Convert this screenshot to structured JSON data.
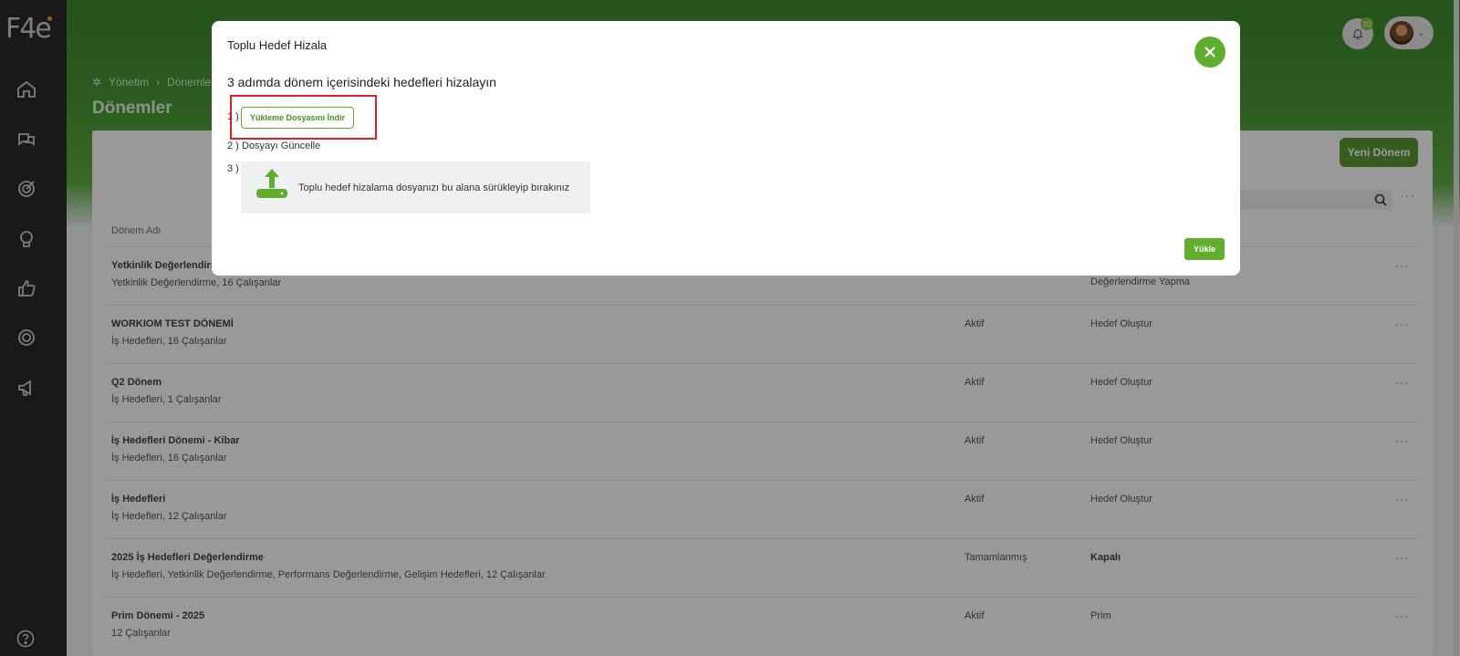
{
  "sidebar": {
    "logo": "F4e",
    "items": [
      {
        "icon": "home-icon"
      },
      {
        "icon": "chat-icon"
      },
      {
        "icon": "target-icon"
      },
      {
        "icon": "lightbulb-icon"
      },
      {
        "icon": "thumbs-up-icon"
      },
      {
        "icon": "ring-icon"
      },
      {
        "icon": "megaphone-icon"
      }
    ],
    "help_icon": "help-icon"
  },
  "header": {
    "notification_count": "10",
    "breadcrumb": [
      "Yönetim",
      "Dönemler"
    ],
    "page_title": "Dönemler"
  },
  "main": {
    "new_button": "Yeni Dönem",
    "column_name": "Dönem Adı",
    "rows": [
      {
        "name": "Yetkinlik Değerlendirm",
        "sub": "Yetkinlik Değerlendirme, 16 Çalışanlar",
        "status": "",
        "stage": "Değerlendirme Yapma"
      },
      {
        "name": "WORKIOM TEST DÖNEMİ",
        "sub": "İş Hedefleri, 16 Çalışanlar",
        "status": "Aktif",
        "stage": "Hedef Oluştur"
      },
      {
        "name": "Q2 Dönem",
        "sub": "İş Hedefleri, 1 Çalışanlar",
        "status": "Aktif",
        "stage": "Hedef Oluştur"
      },
      {
        "name": "İş Hedefleri Dönemi - Kibar",
        "sub": "İş Hedefleri, 16 Çalışanlar",
        "status": "Aktif",
        "stage": "Hedef Oluştur"
      },
      {
        "name": "İş Hedefleri",
        "sub": "İş Hedefleri, 12 Çalışanlar",
        "status": "Aktif",
        "stage": "Hedef Oluştur"
      },
      {
        "name": "2025 İş Hedefleri Değerlendirme",
        "sub": "İş Hedefleri, Yetkinlik Değerlendirme, Performans Değerlendirme, Gelişim Hedefleri, 12 Çalışanlar",
        "status": "Tamamlanmış",
        "stage": "Kapalı"
      },
      {
        "name": "Prim Dönemi - 2025",
        "sub": "12 Çalışanlar",
        "status": "Aktif",
        "stage": "Prim"
      }
    ]
  },
  "modal": {
    "title": "Toplu Hedef Hizala",
    "subtitle": "3 adımda dönem içerisindeki hedefleri hizalayın",
    "step1_num": "1 )",
    "step1_button": "Yükleme Dosyasını İndir",
    "step2_num": "2 )",
    "step2_text": "Dosyayı Güncelle",
    "step3_num": "3 )",
    "dropzone_text": "Toplu hedef hizalama dosyanızı bu alana sürükleyip bırakınız",
    "upload_button": "Yükle"
  },
  "colors": {
    "accent_green": "#5fae2e",
    "sidebar_bg": "#2b2b2b",
    "highlight_red": "#e02020"
  }
}
